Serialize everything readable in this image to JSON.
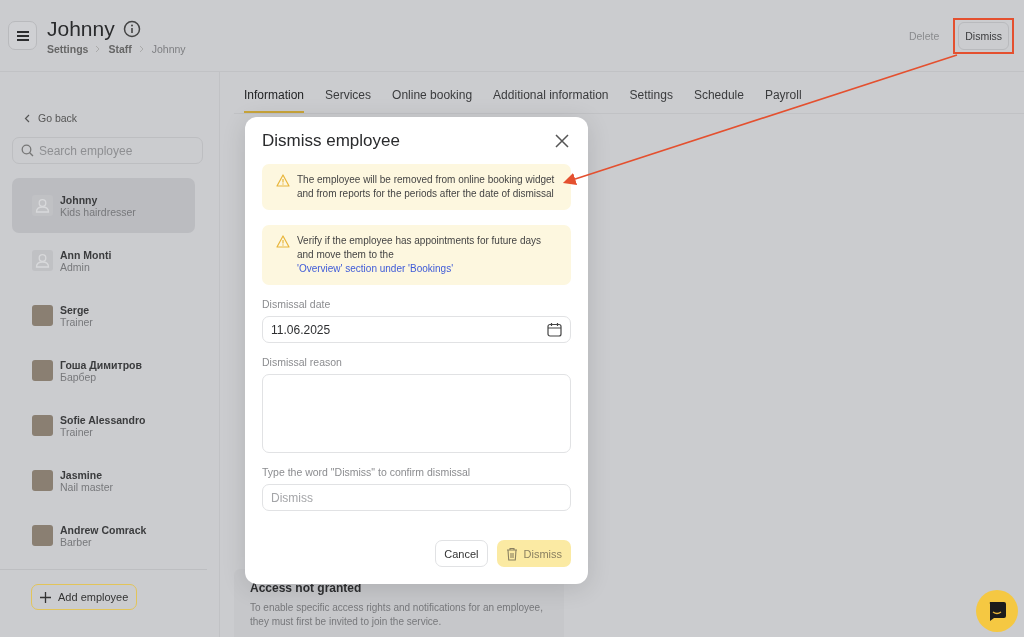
{
  "header": {
    "title": "Johnny",
    "breadcrumbs": [
      {
        "label": "Settings",
        "current": false
      },
      {
        "label": "Staff",
        "current": false
      },
      {
        "label": "Johnny",
        "current": true
      }
    ],
    "actions": [
      {
        "label": "Delete",
        "kind": "text",
        "annotated": false
      },
      {
        "label": "Dismiss",
        "kind": "outlined",
        "annotated": true
      }
    ]
  },
  "sidebar": {
    "back": "Go back",
    "search_placeholder": "Search employee",
    "employees": [
      {
        "name": "Johnny",
        "role": "Kids hairdresser",
        "kind": "placeholder",
        "selected": true
      },
      {
        "name": "Ann Monti",
        "role": "Admin",
        "kind": "placeholder",
        "selected": false
      },
      {
        "name": "Serge",
        "role": "Trainer",
        "kind": "photo",
        "selected": false
      },
      {
        "name": "Гоша Димитров",
        "role": "Барбер",
        "kind": "photo",
        "selected": false
      },
      {
        "name": "Sofie Alessandro",
        "role": "Trainer",
        "kind": "photo",
        "selected": false
      },
      {
        "name": "Jasmine",
        "role": "Nail master",
        "kind": "photo",
        "selected": false
      },
      {
        "name": "Andrew Comrack",
        "role": "Barber",
        "kind": "photo",
        "selected": false
      }
    ],
    "add_button": "Add employee"
  },
  "tabs": [
    {
      "label": "Information",
      "selected": true
    },
    {
      "label": "Services",
      "selected": false
    },
    {
      "label": "Online booking",
      "selected": false
    },
    {
      "label": "Additional information",
      "selected": false
    },
    {
      "label": "Settings",
      "selected": false
    },
    {
      "label": "Schedule",
      "selected": false
    },
    {
      "label": "Payroll",
      "selected": false
    }
  ],
  "access_card": {
    "title": "Access not granted",
    "text": "To enable specific access rights and notifications for an employee, they must first be invited to join the service."
  },
  "modal": {
    "title": "Dismiss employee",
    "alerts": [
      {
        "text": "The employee will be removed from online booking widget and from reports for the periods after the date of dismissal"
      },
      {
        "text": "Verify if the employee has appointments for future days and move them to the",
        "link": "'Overview' section under 'Bookings'"
      }
    ],
    "date_label": "Dismissal date",
    "date_value": "11.06.2025",
    "reason_label": "Dismissal reason",
    "confirm_label": "Type the word \"Dismiss\" to confirm dismissal",
    "confirm_placeholder": "Dismiss",
    "cancel": "Cancel",
    "submit": {
      "label": "Dismiss",
      "disabled": true
    }
  }
}
